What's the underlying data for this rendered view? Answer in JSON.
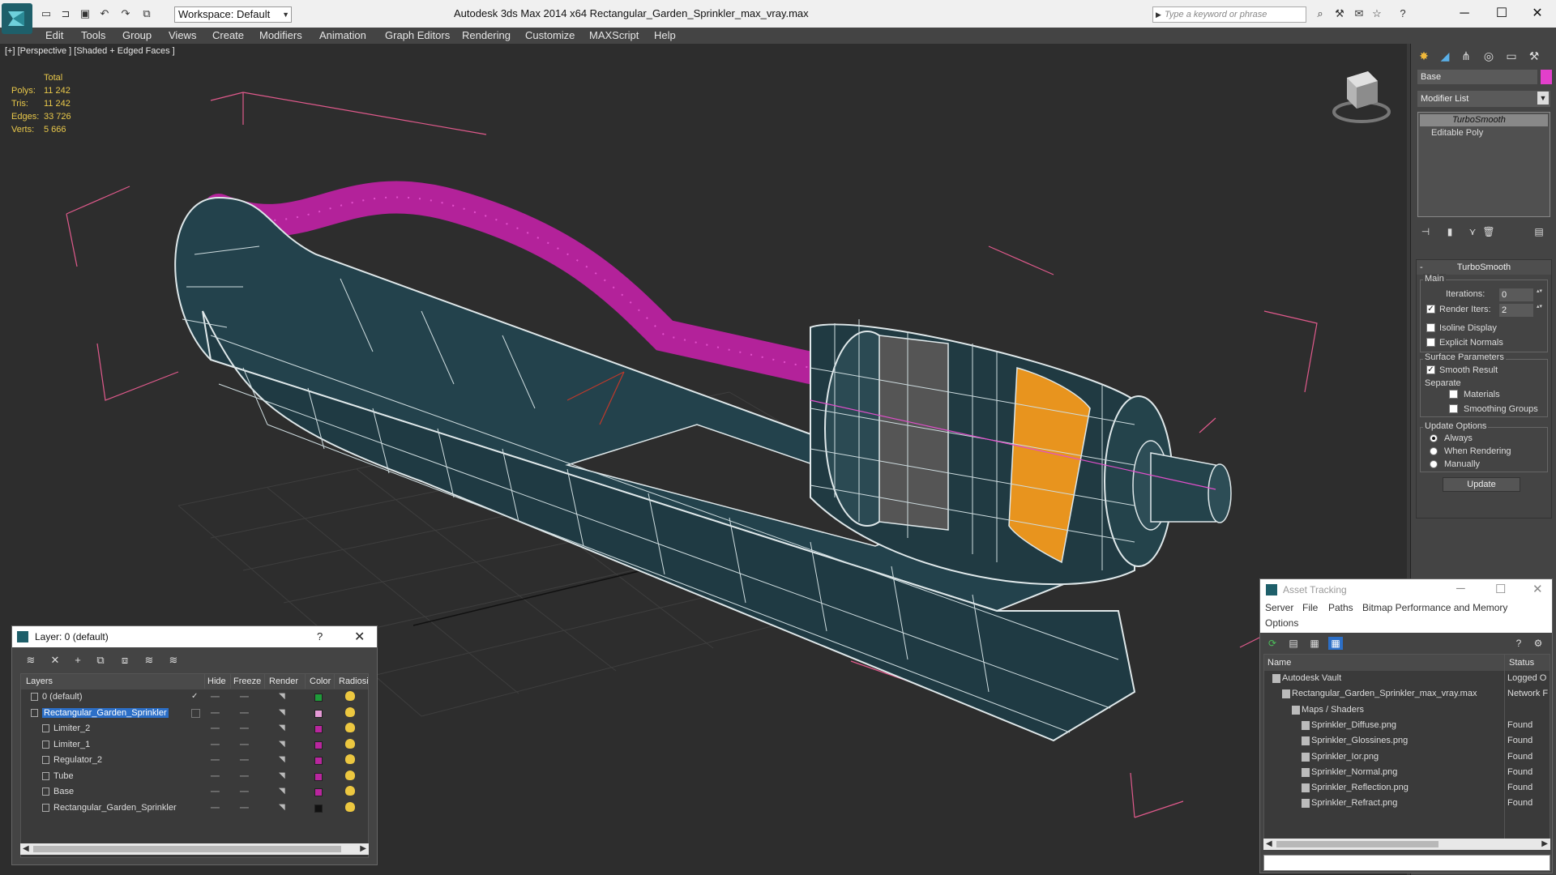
{
  "window": {
    "title": "Autodesk 3ds Max  2014 x64     Rectangular_Garden_Sprinkler_max_vray.max",
    "workspace": "Workspace: Default",
    "search_placeholder": "Type a keyword or phrase"
  },
  "menu": [
    "Edit",
    "Tools",
    "Group",
    "Views",
    "Create",
    "Modifiers",
    "Animation",
    "Graph Editors",
    "Rendering",
    "Customize",
    "MAXScript",
    "Help"
  ],
  "viewport": {
    "label": "[+] [Perspective ] [Shaded + Edged Faces ]",
    "stats": {
      "header": "Total",
      "rows": [
        {
          "k": "Polys:",
          "v": "11 242"
        },
        {
          "k": "Tris:",
          "v": "11 242"
        },
        {
          "k": "Edges:",
          "v": "33 726"
        },
        {
          "k": "Verts:",
          "v": "5 666"
        }
      ]
    }
  },
  "command_panel": {
    "object_name": "Base",
    "object_color": "#e23fcb",
    "modifier_list": "Modifier List",
    "stack": [
      "TurboSmooth",
      "Editable Poly"
    ],
    "rollout_title": "TurboSmooth",
    "main_label": "Main",
    "iterations_label": "Iterations:",
    "iterations_value": "0",
    "render_iters_label": "Render Iters:",
    "render_iters_value": "2",
    "isoline_label": "Isoline Display",
    "explicit_normals_label": "Explicit Normals",
    "surface_params_label": "Surface Parameters",
    "smooth_result_label": "Smooth Result",
    "separate_label": "Separate",
    "materials_label": "Materials",
    "smoothing_groups_label": "Smoothing Groups",
    "update_options_label": "Update Options",
    "always_label": "Always",
    "when_rendering_label": "When Rendering",
    "manually_label": "Manually",
    "update_button": "Update"
  },
  "layer_dialog": {
    "title": "Layer: 0 (default)",
    "help": "?",
    "headers": [
      "Layers",
      "Hide",
      "Freeze",
      "Render",
      "Color",
      "Radiosit"
    ],
    "rows": [
      {
        "name": "0 (default)",
        "color": "#1f9c3a",
        "indent": 0
      },
      {
        "name": "Rectangular_Garden_Sprinkler",
        "color": "#e59ad6",
        "indent": 0
      },
      {
        "name": "Limiter_2",
        "color": "#b9269e",
        "indent": 1
      },
      {
        "name": "Limiter_1",
        "color": "#b9269e",
        "indent": 1
      },
      {
        "name": "Regulator_2",
        "color": "#b9269e",
        "indent": 1
      },
      {
        "name": "Tube",
        "color": "#b9269e",
        "indent": 1
      },
      {
        "name": "Base",
        "color": "#b9269e",
        "indent": 1
      },
      {
        "name": "Rectangular_Garden_Sprinkler",
        "color": "#111111",
        "indent": 1
      }
    ]
  },
  "asset_dialog": {
    "title": "Asset Tracking",
    "menu": [
      "Server",
      "File",
      "Paths",
      "Bitmap Performance and Memory",
      "Options"
    ],
    "headers": [
      "Name",
      "Status"
    ],
    "rows": [
      {
        "name": "Autodesk Vault",
        "status": "Logged O",
        "indent": 1
      },
      {
        "name": "Rectangular_Garden_Sprinkler_max_vray.max",
        "status": "Network F",
        "indent": 2
      },
      {
        "name": "Maps / Shaders",
        "status": "",
        "indent": 3
      },
      {
        "name": "Sprinkler_Diffuse.png",
        "status": "Found",
        "indent": 4
      },
      {
        "name": "Sprinkler_Glossines.png",
        "status": "Found",
        "indent": 4
      },
      {
        "name": "Sprinkler_Ior.png",
        "status": "Found",
        "indent": 4
      },
      {
        "name": "Sprinkler_Normal.png",
        "status": "Found",
        "indent": 4
      },
      {
        "name": "Sprinkler_Reflection.png",
        "status": "Found",
        "indent": 4
      },
      {
        "name": "Sprinkler_Refract.png",
        "status": "Found",
        "indent": 4
      }
    ]
  }
}
